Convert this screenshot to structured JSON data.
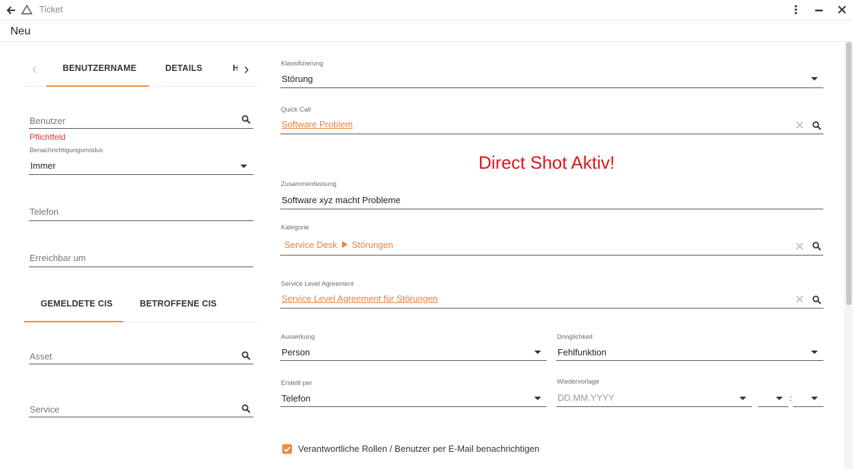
{
  "window": {
    "title": "Ticket"
  },
  "page": {
    "title": "Neu"
  },
  "tabs_top": [
    "BENUTZERNAME",
    "DETAILS",
    "H"
  ],
  "left": {
    "benutzer_placeholder": "Benutzer",
    "benutzer_error": "Pflichtfeld",
    "benachrichtigung_label": "Benachrichtigungsmodus",
    "benachrichtigung_value": "Immer",
    "telefon_placeholder": "Telefon",
    "erreichbar_placeholder": "Erreichbar um"
  },
  "tabs_ci": [
    "GEMELDETE CIS",
    "BETROFFENE CIS"
  ],
  "ci": {
    "asset_placeholder": "Asset",
    "service_placeholder": "Service"
  },
  "right": {
    "klassifizierung_label": "Klassifizierung",
    "klassifizierung_value": "Störung",
    "quickcall_label": "Quick Call",
    "quickcall_value": "Software Problem",
    "alert": "Direct Shot Aktiv!",
    "zusammenfassung_label": "Zusammenfassung",
    "zusammenfassung_value": "Software xyz macht Probleme",
    "kategorie_label": "Kategorie",
    "kategorie_path": [
      "Service Desk",
      "Störungen"
    ],
    "sla_label": "Service Level Agreement",
    "sla_value": "Service Level Agreement für Störungen",
    "auswirkung_label": "Auswirkung",
    "auswirkung_value": "Person",
    "dringlichkeit_label": "Dringlichkeit",
    "dringlichkeit_value": "Fehlfunktion",
    "erstellt_label": "Erstellt per",
    "erstellt_value": "Telefon",
    "wiedervorlage_label": "Wiedervorlage",
    "wiedervorlage_placeholder": "DD.MM.YYYY",
    "time_separator": ":",
    "notify_checked": true,
    "notify_label": "Verantwortliche Rollen / Benutzer per E-Mail benachrichtigen"
  },
  "colors": {
    "accent": "#f0883e",
    "alert": "#e0151b",
    "error": "#dd3333"
  },
  "icons": [
    "back-arrow-icon",
    "app-logo-icon",
    "more-vert-icon",
    "minimize-icon",
    "close-icon",
    "chevron-left-icon",
    "chevron-right-icon",
    "search-icon",
    "clear-icon",
    "dropdown-arrow-icon",
    "breadcrumb-arrow-icon",
    "checkmark-icon"
  ]
}
